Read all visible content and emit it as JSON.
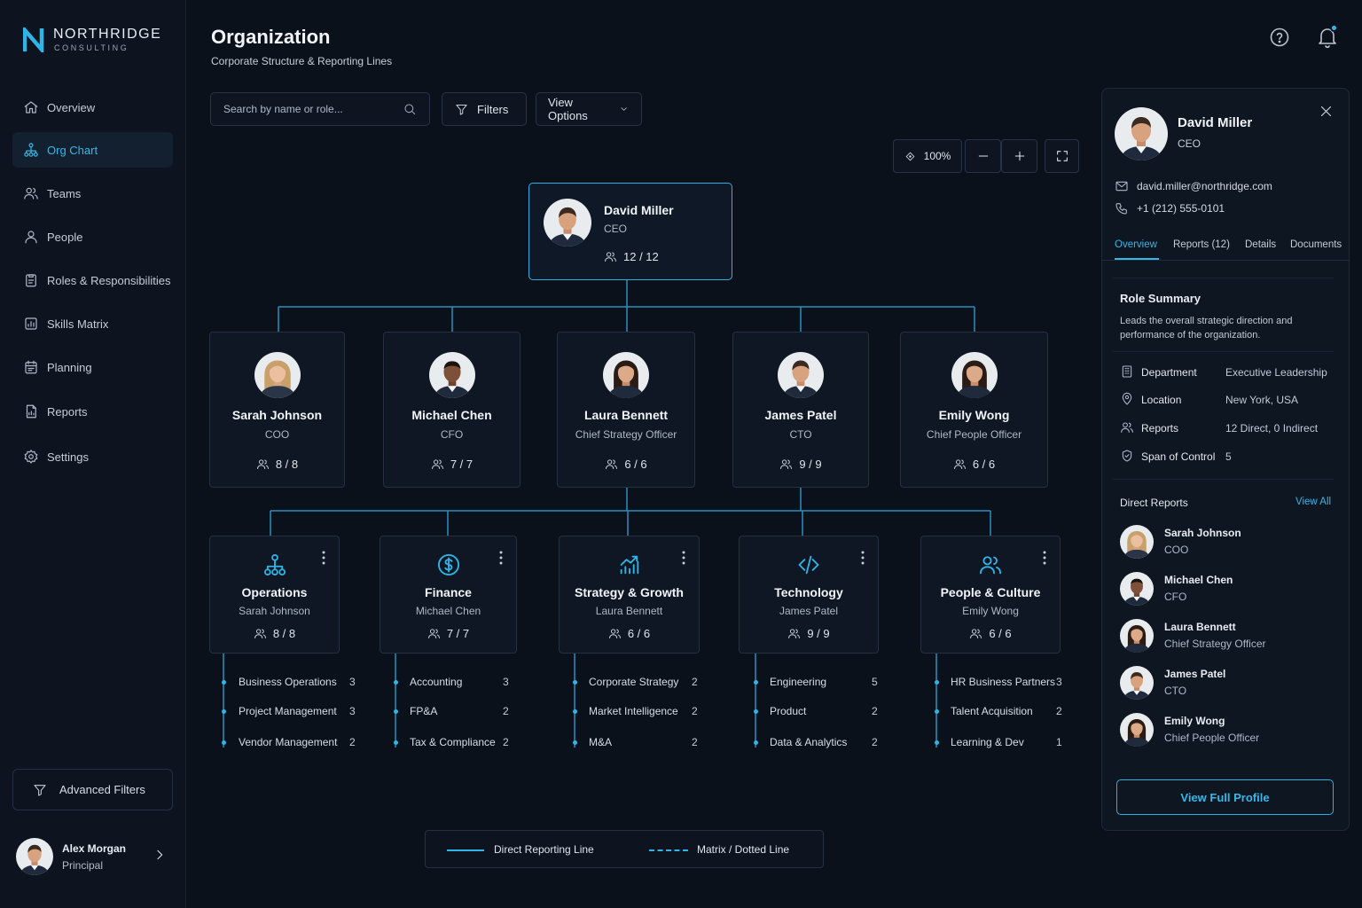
{
  "brand": {
    "name": "NORTHRIDGE",
    "sub": "CONSULTING"
  },
  "nav": [
    {
      "label": "Overview",
      "icon": "home-icon"
    },
    {
      "label": "Org Chart",
      "icon": "org-chart-icon",
      "active": true
    },
    {
      "label": "Teams",
      "icon": "teams-icon"
    },
    {
      "label": "People",
      "icon": "person-icon"
    },
    {
      "label": "Roles & Responsibilities",
      "icon": "clipboard-icon"
    },
    {
      "label": "Skills Matrix",
      "icon": "skills-icon"
    },
    {
      "label": "Planning",
      "icon": "calendar-icon"
    },
    {
      "label": "Reports",
      "icon": "reports-icon"
    },
    {
      "label": "Settings",
      "icon": "gear-icon"
    }
  ],
  "advanced_filters": "Advanced Filters",
  "user": {
    "name": "Alex Morgan",
    "role": "Principal"
  },
  "header": {
    "title": "Organization",
    "subtitle": "Corporate Structure & Reporting Lines"
  },
  "toolbar": {
    "search_placeholder": "Search by name or role...",
    "filters": "Filters",
    "view_options": "View Options",
    "zoom": "100%"
  },
  "ceo": {
    "name": "David Miller",
    "title": "CEO",
    "count": "12 / 12"
  },
  "executives": [
    {
      "name": "Sarah Johnson",
      "title": "COO",
      "count": "8 / 8"
    },
    {
      "name": "Michael Chen",
      "title": "CFO",
      "count": "7 / 7"
    },
    {
      "name": "Laura Bennett",
      "title": "Chief Strategy Officer",
      "count": "6 / 6"
    },
    {
      "name": "James Patel",
      "title": "CTO",
      "count": "9 / 9"
    },
    {
      "name": "Emily Wong",
      "title": "Chief People Officer",
      "count": "6 / 6"
    }
  ],
  "departments": [
    {
      "name": "Operations",
      "lead": "Sarah Johnson",
      "count": "8 / 8",
      "icon": "operations-icon",
      "subteams": [
        {
          "label": "Business Operations",
          "count": "3"
        },
        {
          "label": "Project Management",
          "count": "3"
        },
        {
          "label": "Vendor Management",
          "count": "2"
        }
      ]
    },
    {
      "name": "Finance",
      "lead": "Michael Chen",
      "count": "7 / 7",
      "icon": "dollar-icon",
      "subteams": [
        {
          "label": "Accounting",
          "count": "3"
        },
        {
          "label": "FP&A",
          "count": "2"
        },
        {
          "label": "Tax & Compliance",
          "count": "2"
        }
      ]
    },
    {
      "name": "Strategy & Growth",
      "lead": "Laura Bennett",
      "count": "6 / 6",
      "icon": "growth-chart-icon",
      "subteams": [
        {
          "label": "Corporate Strategy",
          "count": "2"
        },
        {
          "label": "Market Intelligence",
          "count": "2"
        },
        {
          "label": "M&A",
          "count": "2"
        }
      ]
    },
    {
      "name": "Technology",
      "lead": "James Patel",
      "count": "9 / 9",
      "icon": "code-icon",
      "subteams": [
        {
          "label": "Engineering",
          "count": "5"
        },
        {
          "label": "Product",
          "count": "2"
        },
        {
          "label": "Data & Analytics",
          "count": "2"
        }
      ]
    },
    {
      "name": "People & Culture",
      "lead": "Emily Wong",
      "count": "6 / 6",
      "icon": "people-icon",
      "subteams": [
        {
          "label": "HR Business Partners",
          "count": "3"
        },
        {
          "label": "Talent Acquisition",
          "count": "2"
        },
        {
          "label": "Learning & Dev",
          "count": "1"
        }
      ]
    }
  ],
  "legend": {
    "direct": "Direct Reporting Line",
    "matrix": "Matrix / Dotted Line"
  },
  "detail": {
    "name": "David Miller",
    "title": "CEO",
    "email": "david.miller@northridge.com",
    "phone": "+1 (212) 555-0101",
    "tabs": [
      "Overview",
      "Reports (12)",
      "Details",
      "Documents"
    ],
    "summary_heading": "Role Summary",
    "summary_line1": "Leads the overall strategic direction and",
    "summary_line2": "performance of the organization.",
    "fields": [
      {
        "label": "Department",
        "value": "Executive Leadership",
        "icon": "building-icon"
      },
      {
        "label": "Location",
        "value": "New York, USA",
        "icon": "location-pin-icon"
      },
      {
        "label": "Reports",
        "value": "12 Direct, 0 Indirect",
        "icon": "reports-people-icon"
      },
      {
        "label": "Span of Control",
        "value": "5",
        "icon": "shield-icon"
      }
    ],
    "direct_reports_heading": "Direct Reports",
    "view_all": "View All",
    "reports": [
      {
        "name": "Sarah Johnson",
        "title": "COO"
      },
      {
        "name": "Michael Chen",
        "title": "CFO"
      },
      {
        "name": "Laura Bennett",
        "title": "Chief Strategy Officer"
      },
      {
        "name": "James Patel",
        "title": "CTO"
      },
      {
        "name": "Emily Wong",
        "title": "Chief People Officer"
      }
    ],
    "view_profile": "View Full Profile"
  },
  "colors": {
    "accent": "#2fb4e6",
    "background": "#0b111b",
    "card": "#0f1724",
    "border": "#253043"
  }
}
